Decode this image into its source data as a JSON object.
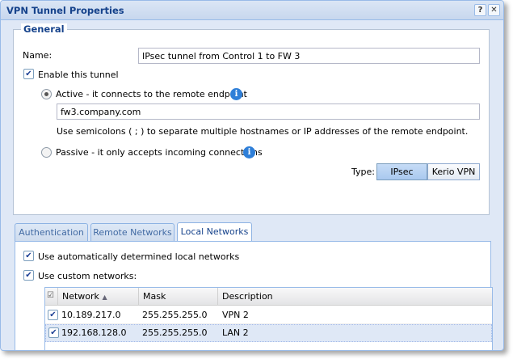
{
  "window": {
    "title": "VPN Tunnel Properties",
    "help_glyph": "?",
    "close_glyph": "✕"
  },
  "general": {
    "legend": "General",
    "name_label": "Name:",
    "name_value": "IPsec tunnel from Control 1 to FW 3",
    "enable_label": "Enable this tunnel",
    "enable_checked": true,
    "active_label": "Active - it connects to the remote endpoint",
    "active_selected": true,
    "endpoint_value": "fw3.company.com",
    "endpoint_hint": "Use semicolons ( ; ) to separate multiple hostnames or IP addresses of the remote endpoint.",
    "passive_label": "Passive - it only accepts incoming connections",
    "passive_selected": false,
    "type_label": "Type:",
    "type_options": [
      "IPsec",
      "Kerio VPN"
    ],
    "type_selected": "IPsec"
  },
  "tabs": [
    "Authentication",
    "Remote Networks",
    "Local Networks"
  ],
  "active_tab": "Local Networks",
  "local_networks": {
    "auto_label": "Use automatically determined local networks",
    "auto_checked": true,
    "custom_label": "Use custom networks:",
    "custom_checked": true,
    "columns": [
      "Network",
      "Mask",
      "Description"
    ],
    "sort_indicator": "▲",
    "rows": [
      {
        "checked": true,
        "network": "10.189.217.0",
        "mask": "255.255.255.0",
        "description": "VPN 2"
      },
      {
        "checked": true,
        "network": "192.168.128.0",
        "mask": "255.255.255.0",
        "description": "LAN 2"
      }
    ]
  },
  "colors": {
    "accent": "#15428b",
    "panel_bg": "#dfe8f6",
    "border": "#99bbe8",
    "info_icon": "#2f7fd8"
  },
  "icons": {
    "info": "info-icon",
    "check": "checkmark-icon",
    "help": "help-icon",
    "close": "close-icon"
  },
  "glyphs": {
    "check": "✔",
    "info": "i",
    "header_check": "☑"
  }
}
